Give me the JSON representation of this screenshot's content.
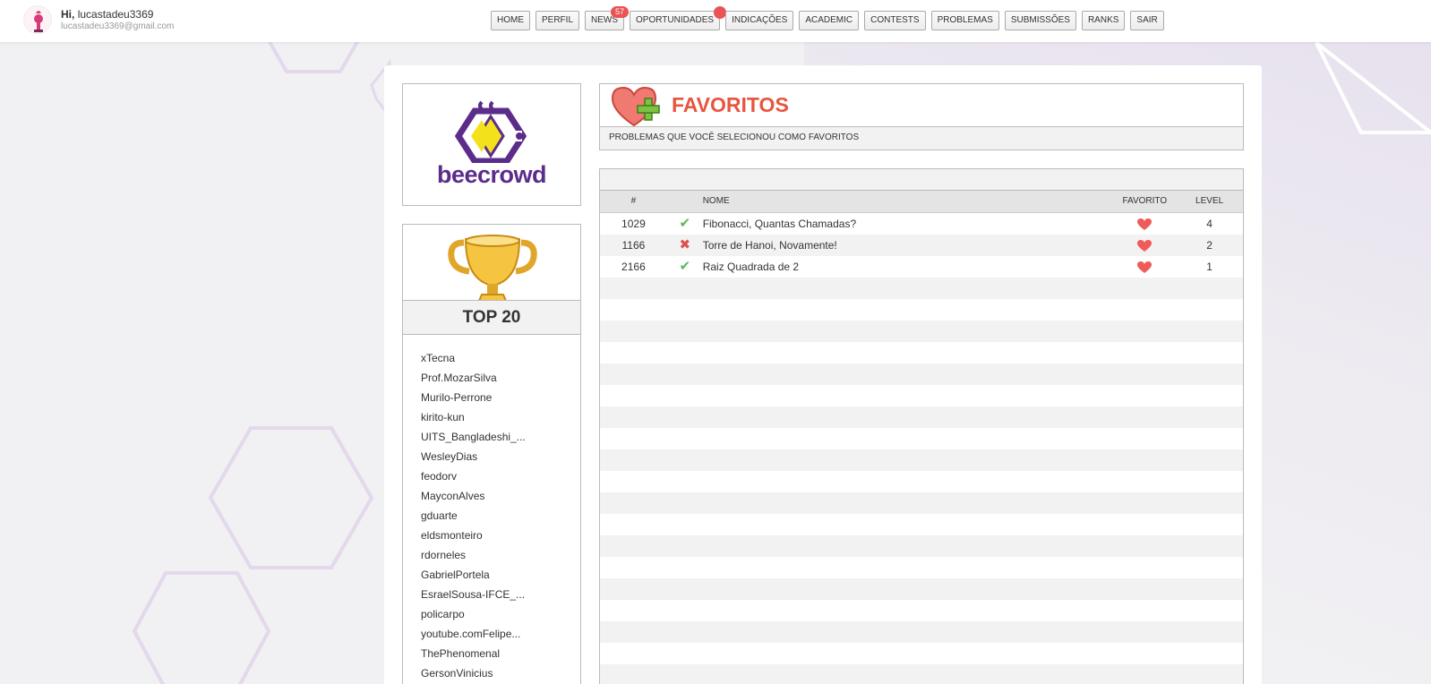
{
  "user": {
    "greeting_prefix": "Hi,",
    "username": "lucastadeu3369",
    "email": "lucastadeu3369@gmail.com"
  },
  "nav": {
    "items": [
      {
        "label": "HOME"
      },
      {
        "label": "PERFIL"
      },
      {
        "label": "NEWS",
        "badge": "57"
      },
      {
        "label": "OPORTUNIDADES",
        "dot": true
      },
      {
        "label": "INDICAÇÕES"
      },
      {
        "label": "ACADEMIC"
      },
      {
        "label": "CONTESTS"
      },
      {
        "label": "PROBLEMAS"
      },
      {
        "label": "SUBMISSÕES"
      },
      {
        "label": "RANKS"
      },
      {
        "label": "SAIR"
      }
    ]
  },
  "sidebar": {
    "logo_text": "beecrowd",
    "top_title": "TOP 20",
    "top_users": [
      "xTecna",
      "Prof.MozarSilva",
      "Murilo-Perrone",
      "kirito-kun",
      "UITS_Bangladeshi_...",
      "WesleyDias",
      "feodorv",
      "MayconAlves",
      "gduarte",
      "eldsmonteiro",
      "rdorneles",
      "GabrielPortela",
      "EsraelSousa-IFCE_...",
      "policarpo",
      "youtube.comFelipe...",
      "ThePhenomenal",
      "GersonVinicius"
    ]
  },
  "favorites": {
    "title": "FAVORITOS",
    "subtitle": "PROBLEMAS QUE VOCÊ SELECIONOU COMO FAVORITOS",
    "columns": {
      "num": "#",
      "name": "NOME",
      "favorite": "FAVORITO",
      "level": "LEVEL"
    },
    "rows": [
      {
        "id": "1029",
        "status": "solved",
        "name": "Fibonacci, Quantas Chamadas?",
        "level": "4"
      },
      {
        "id": "1166",
        "status": "wrong",
        "name": "Torre de Hanoi, Novamente!",
        "level": "2"
      },
      {
        "id": "2166",
        "status": "solved",
        "name": "Raiz Quadrada de 2",
        "level": "1"
      }
    ],
    "empty_rows": 19
  },
  "colors": {
    "accent_red": "#e8553e",
    "brand_purple": "#5b2c8a",
    "solved_green": "#5cb85c",
    "wrong_red": "#e04f4f",
    "badge_red": "#ea5455",
    "heart": "#ef5b5b"
  },
  "icons": {
    "solved": "check-icon",
    "wrong": "cross-icon",
    "favorite": "heart-icon"
  }
}
